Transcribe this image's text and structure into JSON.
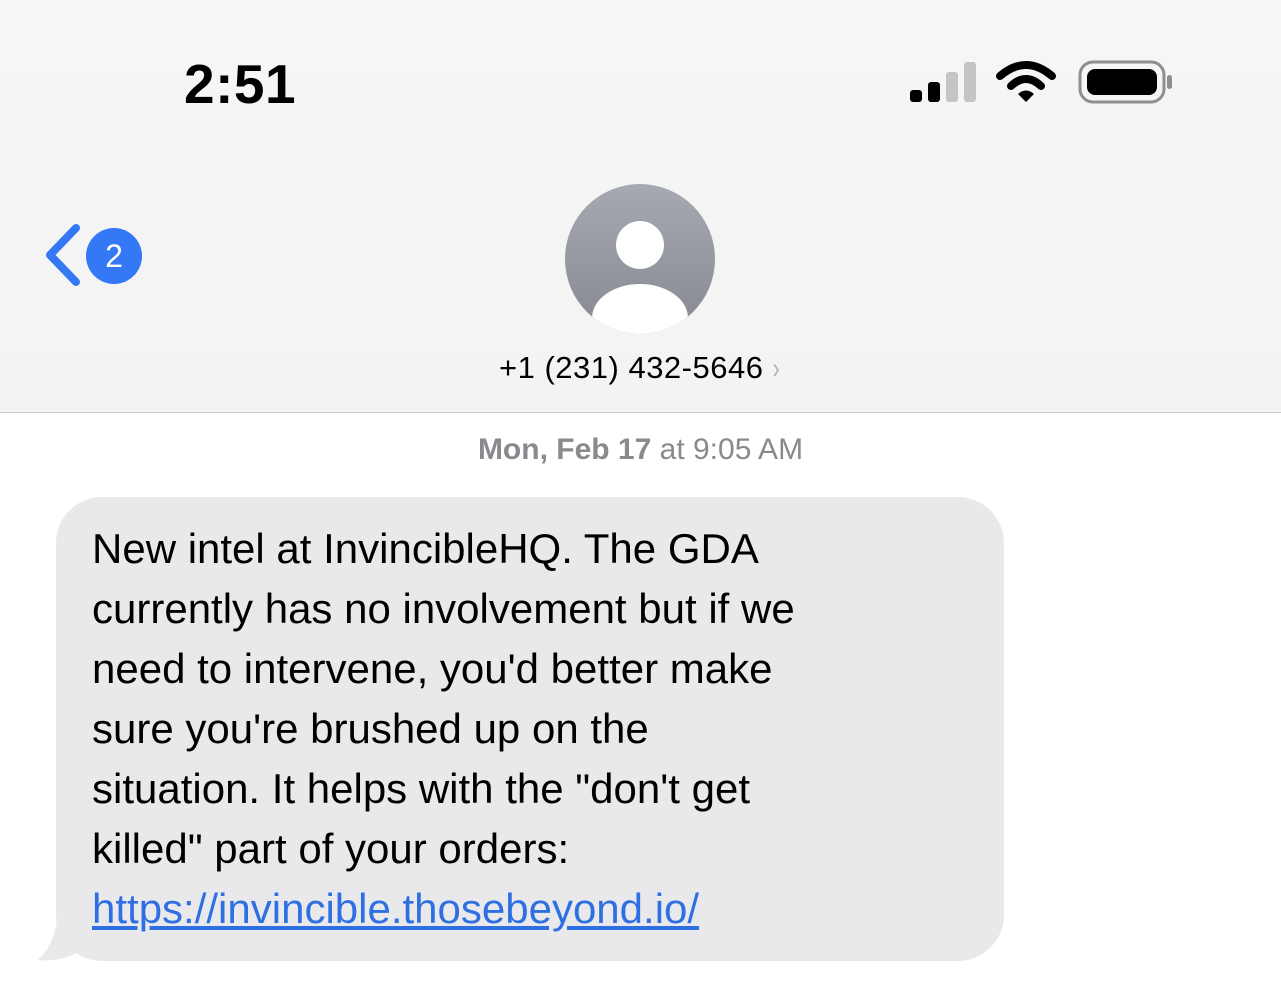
{
  "status_bar": {
    "time": "2:51",
    "icons": [
      "signal-icon",
      "wifi-icon",
      "battery-icon"
    ]
  },
  "nav": {
    "back_icon": "chevron-left-icon",
    "unread_count": "2",
    "avatar_icon": "person-icon",
    "contact_name": "+1 (231) 432-5646",
    "contact_chevron": "›"
  },
  "conversation": {
    "timestamp_day": "Mon, Feb 17",
    "timestamp_time": " at 9:05 AM",
    "messages": [
      {
        "direction": "incoming",
        "text": "New intel at InvincibleHQ. The GDA\ncurrently has no involvement but if we\nneed to intervene, you'd better make\nsure you're brushed up on the\nsituation. It helps with the \"don't get\nkilled\" part of your orders:",
        "link": "https://invincible.thosebeyond.io/"
      }
    ]
  },
  "colors": {
    "accent": "#3478f6",
    "bubble_incoming": "#e9e9eb",
    "link": "#2f6fe4",
    "secondary_text": "#8a8a8e"
  }
}
